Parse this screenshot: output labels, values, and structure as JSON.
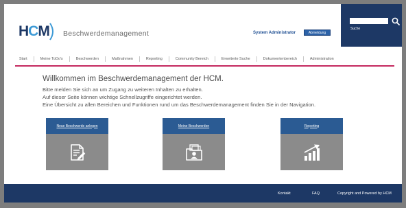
{
  "app": {
    "logo_letters": [
      "H",
      "C",
      "M"
    ],
    "title": "Beschwerdemanagement"
  },
  "header": {
    "user": "System Administrator",
    "logout_label": "Abmeldung",
    "search": {
      "value": "",
      "label": "Suche",
      "icon": "search-icon"
    }
  },
  "nav": {
    "items": [
      "Start",
      "Meine ToDo's",
      "Beschwerden",
      "Maßnahmen",
      "Reporting",
      "Community Bereich",
      "Erweiterte Suche",
      "Dokumentenbereich",
      "Administration"
    ],
    "active": "Start"
  },
  "main": {
    "heading": "Willkommen im Beschwerdemanagement der HCM.",
    "lines": [
      "Bitte melden Sie sich an um Zugang zu weiteren Inhalten zu erhalten.",
      "Auf dieser Seite können wichtige Schnellzugriffe eingerichtet werden.",
      "Eine Übersicht zu allen Bereichen und Funktionen rund um das Beschwerdemanagement finden Sie in der Navigation."
    ]
  },
  "tiles": [
    {
      "label": "Neue Beschwerde anlegen",
      "icon": "document-edit-icon"
    },
    {
      "label": "Meine Beschwerden",
      "icon": "folder-user-icon"
    },
    {
      "label": "Reporting",
      "icon": "chart-growth-icon"
    }
  ],
  "footer": {
    "links": [
      "Kontakt",
      "FAQ",
      "Copyright and Powered by HCM"
    ]
  },
  "colors": {
    "navy": "#1d3865",
    "tile_blue": "#2b5b93",
    "tile_gray": "#8b8b8b",
    "accent": "#c4285e",
    "link_blue": "#1f4f93"
  }
}
